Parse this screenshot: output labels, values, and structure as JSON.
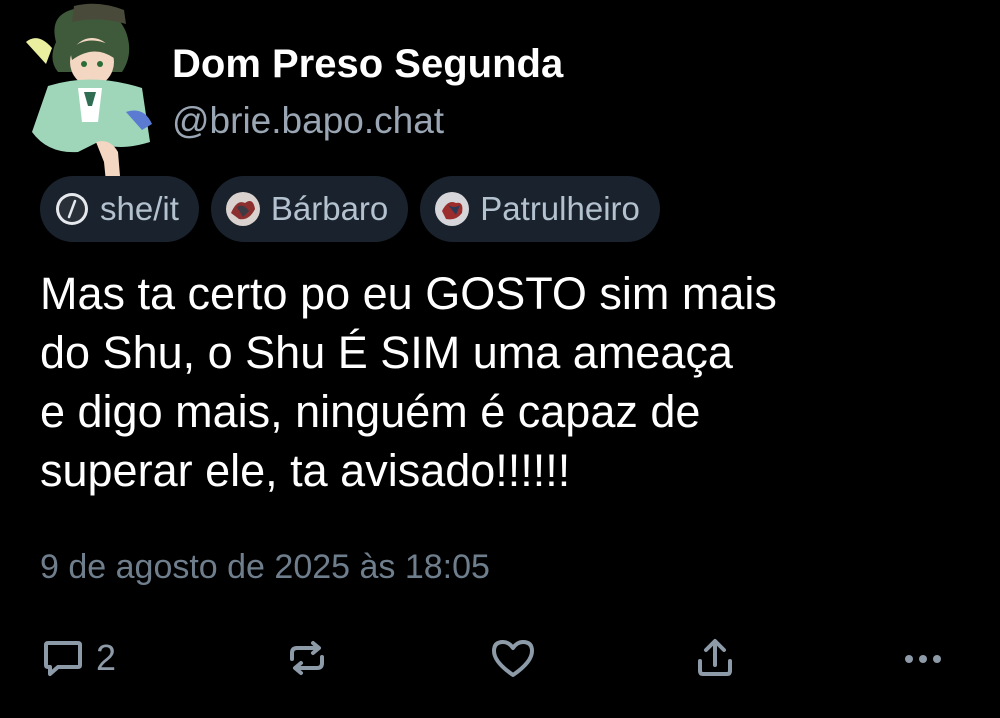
{
  "profile": {
    "display_name": "Dom Preso Segunda",
    "handle": "@brie.bapo.chat",
    "avatar_icon": "anime-character-avatar"
  },
  "labels": [
    {
      "text": "she/it",
      "icon": "pronoun-slash-icon"
    },
    {
      "text": "Bárbaro",
      "icon": "badge-image-icon"
    },
    {
      "text": "Patrulheiro",
      "icon": "badge-image-icon"
    }
  ],
  "post": {
    "lines": [
      "Mas ta certo po eu GOSTO sim mais",
      "do Shu, o Shu É SIM uma ameaça",
      "e digo mais, ninguém é capaz de",
      "superar ele, ta avisado!!!!!!"
    ],
    "timestamp": "9 de agosto de 2025 às 18:05"
  },
  "actions": {
    "reply_count": "2",
    "reply_icon": "reply-bubble-icon",
    "repost_icon": "repost-icon",
    "like_icon": "heart-icon",
    "share_icon": "share-icon",
    "more_icon": "more-dots-icon"
  },
  "colors": {
    "background": "#000000",
    "chip_bg": "#1a232d",
    "chip_text": "#b4c2d0",
    "muted_text": "#6f7e8c",
    "handle_text": "#9aa6b3",
    "icon": "#8d9aa8"
  }
}
